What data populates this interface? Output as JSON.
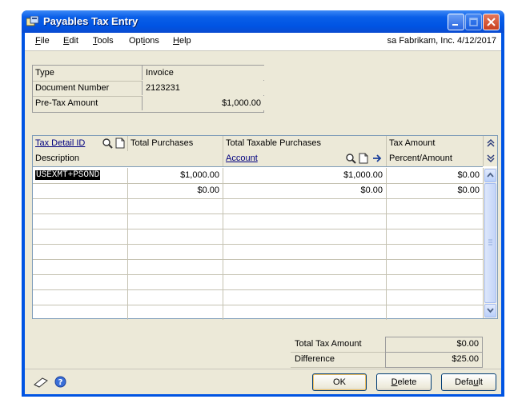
{
  "window": {
    "title": "Payables Tax Entry"
  },
  "menu": {
    "items": [
      {
        "label": "File",
        "accel": "F",
        "rest": "ile"
      },
      {
        "label": "Edit",
        "accel": "E",
        "rest": "dit"
      },
      {
        "label": "Tools",
        "accel": "T",
        "rest": "ools"
      },
      {
        "label": "Options",
        "pre": "Opt",
        "accel": "i",
        "rest": "ons"
      },
      {
        "label": "Help",
        "accel": "H",
        "rest": "elp"
      }
    ],
    "company_info": "sa  Fabrikam, Inc.  4/12/2017"
  },
  "info": {
    "type_label": "Type",
    "type_value": "Invoice",
    "docnum_label": "Document Number",
    "docnum_value": "2123231",
    "pretax_label": "Pre-Tax Amount",
    "pretax_value": "$1,000.00"
  },
  "grid": {
    "headers": {
      "tax_detail_id": "Tax Detail ID",
      "total_purchases": "Total Purchases",
      "total_taxable_purchases": "Total Taxable Purchases",
      "tax_amount": "Tax Amount",
      "description": "Description",
      "account": "Account",
      "percent_amount": "Percent/Amount"
    },
    "rows": [
      {
        "tax_detail_id": "USEXMT+PSOND",
        "total_purchases": "$1,000.00",
        "taxable": "$1,000.00",
        "tax_amount": "$0.00"
      },
      {
        "tax_detail_id": "",
        "total_purchases": "$0.00",
        "taxable": "$0.00",
        "tax_amount": "$0.00"
      }
    ]
  },
  "totals": {
    "total_tax_label": "Total Tax Amount",
    "total_tax_value": "$0.00",
    "difference_label": "Difference",
    "difference_value": "$25.00"
  },
  "buttons": {
    "ok": "OK",
    "delete_accel": "D",
    "delete_rest": "elete",
    "default_pre": "Defa",
    "default_accel": "u",
    "default_rest": "lt"
  },
  "colors": {
    "titlebar": "#0054e3",
    "client": "#ece9d8",
    "link": "#00007f"
  }
}
